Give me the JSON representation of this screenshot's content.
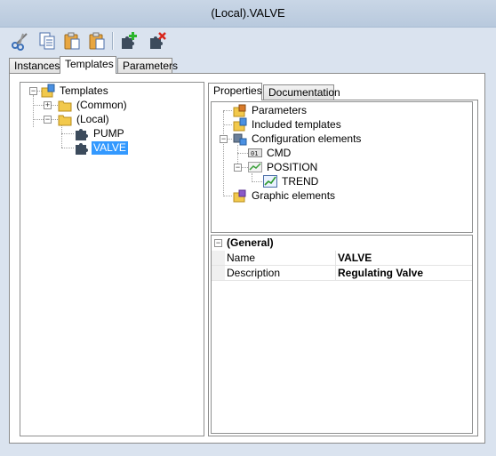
{
  "window": {
    "title": "(Local).VALVE"
  },
  "toolbar": {
    "buttons": [
      {
        "name": "cut",
        "icon": "scissors-icon"
      },
      {
        "name": "copy",
        "icon": "copy-icon"
      },
      {
        "name": "paste",
        "icon": "paste-icon"
      },
      {
        "name": "paste-special",
        "icon": "paste-icon"
      },
      {
        "name": "add-template",
        "icon": "puzzle-add-icon"
      },
      {
        "name": "delete-template",
        "icon": "puzzle-delete-icon"
      }
    ]
  },
  "tabs": [
    {
      "label": "Instances",
      "active": false
    },
    {
      "label": "Templates",
      "active": true
    },
    {
      "label": "Parameters",
      "active": false
    }
  ],
  "template_tree": {
    "root": "Templates",
    "folders": [
      "(Common)",
      "(Local)"
    ],
    "local_items": [
      "PUMP",
      "VALVE"
    ],
    "selected": "VALVE"
  },
  "detail_tabs": [
    {
      "label": "Properties",
      "active": true
    },
    {
      "label": "Documentation",
      "active": false
    }
  ],
  "structure_tree": {
    "parameters": "Parameters",
    "included_templates": "Included templates",
    "configuration_elements": "Configuration elements",
    "cmd": "CMD",
    "position": "POSITION",
    "trend": "TREND",
    "graphic_elements": "Graphic elements"
  },
  "properties": {
    "group": "(General)",
    "rows": [
      {
        "name": "Name",
        "value": "VALVE"
      },
      {
        "name": "Description",
        "value": "Regulating Valve"
      }
    ]
  },
  "colors": {
    "selection": "#3399ff",
    "window_bg": "#dae3ef",
    "title_bg": "#c9d6e6"
  }
}
